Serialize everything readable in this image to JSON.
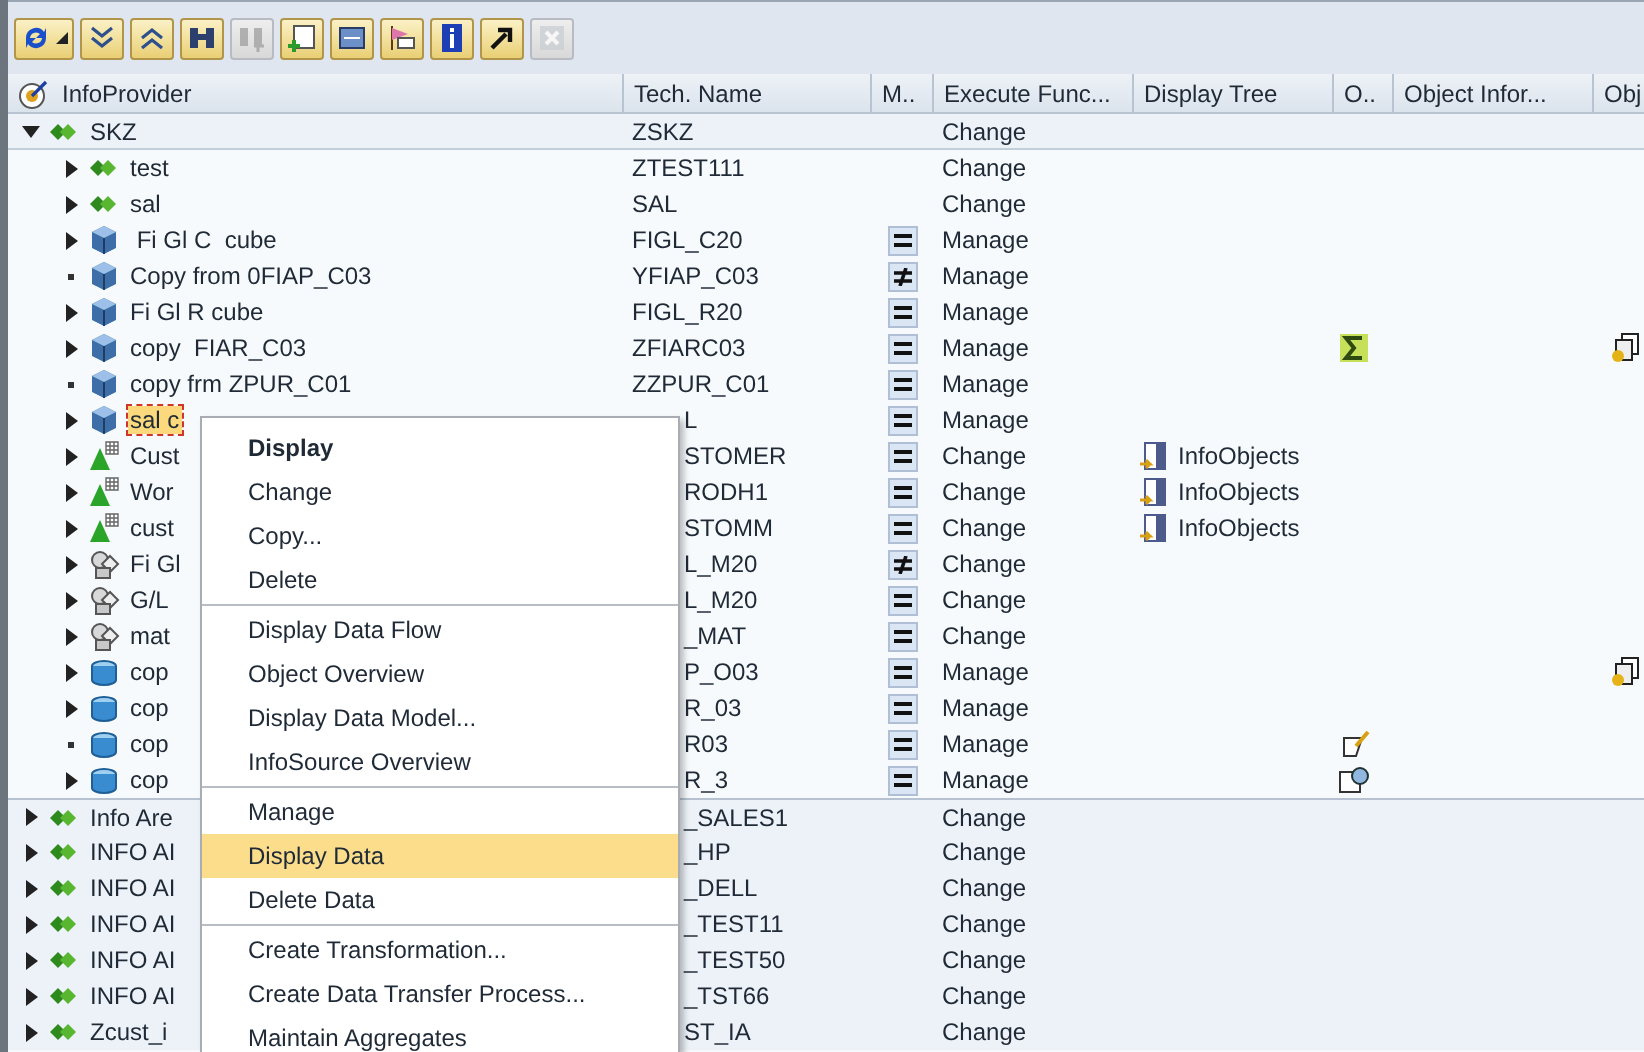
{
  "toolbar": [
    {
      "kind": "refresh",
      "has_menu": true,
      "disabled": false
    },
    {
      "kind": "expand",
      "has_menu": false,
      "disabled": false
    },
    {
      "kind": "collapse",
      "has_menu": false,
      "disabled": false
    },
    {
      "kind": "find",
      "has_menu": false,
      "disabled": false
    },
    {
      "kind": "find-next",
      "has_menu": false,
      "disabled": true
    },
    {
      "kind": "create",
      "has_menu": false,
      "disabled": false
    },
    {
      "kind": "screen",
      "has_menu": false,
      "disabled": false
    },
    {
      "kind": "flag",
      "has_menu": false,
      "disabled": false
    },
    {
      "kind": "info",
      "has_menu": false,
      "disabled": false
    },
    {
      "kind": "jump",
      "has_menu": false,
      "disabled": false
    },
    {
      "kind": "cancel",
      "has_menu": false,
      "disabled": true
    }
  ],
  "table": {
    "columns": [
      "InfoProvider",
      "Tech. Name",
      "M..",
      "Execute Func...",
      "Display Tree",
      "O..",
      "Object Infor...",
      "Obj"
    ],
    "rows": [
      {
        "label": "SKZ",
        "tech_name": "ZSKZ",
        "kind": "area",
        "expanded": true,
        "leaf": false,
        "selected": false,
        "execute": "Change",
        "children": [
          {
            "label": "test",
            "tech_name": "ZTEST111",
            "kind": "area",
            "expanded": false,
            "leaf": false,
            "selected": false,
            "execute": "Change"
          },
          {
            "label": "sal",
            "tech_name": "SAL",
            "kind": "area",
            "expanded": false,
            "leaf": false,
            "selected": false,
            "execute": "Change"
          },
          {
            "label": " Fi Gl C  cube",
            "tech_name": "FIGL_C20",
            "kind": "cube",
            "expanded": false,
            "leaf": false,
            "selected": false,
            "m_column": {
              "kind": "equal"
            },
            "execute": "Manage"
          },
          {
            "label": "Copy from 0FIAP_C03",
            "tech_name": "YFIAP_C03",
            "kind": "cube",
            "leaf": true,
            "selected": false,
            "m_column": {
              "kind": "unequal"
            },
            "execute": "Manage"
          },
          {
            "label": "Fi Gl R cube",
            "tech_name": "FIGL_R20",
            "kind": "cube",
            "expanded": false,
            "leaf": false,
            "selected": false,
            "m_column": {
              "kind": "equal"
            },
            "execute": "Manage"
          },
          {
            "label": "copy  FIAR_C03",
            "tech_name": "ZFIARC03",
            "kind": "cube",
            "expanded": false,
            "leaf": false,
            "selected": false,
            "m_column": {
              "kind": "equal"
            },
            "execute": "Manage",
            "o_column": {
              "kind": "sum"
            },
            "obj_column": {
              "kind": "copy"
            }
          },
          {
            "label": "copy frm ZPUR_C01",
            "tech_name": "ZZPUR_C01",
            "kind": "cube",
            "leaf": true,
            "selected": false,
            "m_column": {
              "kind": "equal"
            },
            "execute": "Manage"
          },
          {
            "label": "sal c",
            "tech_name": "L",
            "kind": "cube",
            "expanded": false,
            "leaf": false,
            "selected": true,
            "m_column": {
              "kind": "equal"
            },
            "execute": "Manage"
          },
          {
            "label": "Cust",
            "tech_name": "STOMER",
            "kind": "multiprovider",
            "expanded": false,
            "leaf": false,
            "selected": false,
            "m_column": {
              "kind": "equal"
            },
            "execute": "Change",
            "display_tree": "InfoObjects"
          },
          {
            "label": "Wor",
            "tech_name": "RODH1",
            "kind": "multiprovider",
            "expanded": false,
            "leaf": false,
            "selected": false,
            "m_column": {
              "kind": "equal"
            },
            "execute": "Change",
            "display_tree": "InfoObjects"
          },
          {
            "label": "cust",
            "tech_name": "STOMM",
            "kind": "multiprovider",
            "expanded": false,
            "leaf": false,
            "selected": false,
            "m_column": {
              "kind": "equal"
            },
            "execute": "Change",
            "display_tree": "InfoObjects"
          },
          {
            "label": "Fi Gl",
            "tech_name": "L_M20",
            "kind": "infoset",
            "expanded": false,
            "leaf": false,
            "selected": false,
            "m_column": {
              "kind": "unequal"
            },
            "execute": "Change"
          },
          {
            "label": "G/L",
            "tech_name": "L_M20",
            "kind": "infoset",
            "expanded": false,
            "leaf": false,
            "selected": false,
            "m_column": {
              "kind": "equal"
            },
            "execute": "Change"
          },
          {
            "label": "mat",
            "tech_name": "_MAT",
            "kind": "infoset",
            "expanded": false,
            "leaf": false,
            "selected": false,
            "m_column": {
              "kind": "equal"
            },
            "execute": "Change"
          },
          {
            "label": "cop",
            "tech_name": "P_O03",
            "kind": "dso",
            "expanded": false,
            "leaf": false,
            "selected": false,
            "m_column": {
              "kind": "equal"
            },
            "execute": "Manage",
            "obj_column": {
              "kind": "copy"
            }
          },
          {
            "label": "cop",
            "tech_name": "R_03",
            "kind": "dso",
            "expanded": false,
            "leaf": false,
            "selected": false,
            "m_column": {
              "kind": "equal"
            },
            "execute": "Manage"
          },
          {
            "label": "cop",
            "tech_name": "R03",
            "kind": "dso",
            "leaf": true,
            "selected": false,
            "m_column": {
              "kind": "equal"
            },
            "execute": "Manage",
            "o_column": {
              "kind": "edit"
            }
          },
          {
            "label": "cop",
            "tech_name": "R_3",
            "kind": "dso",
            "expanded": false,
            "leaf": false,
            "selected": false,
            "m_column": {
              "kind": "equal"
            },
            "execute": "Manage",
            "o_column": {
              "kind": "clock"
            }
          }
        ]
      },
      {
        "label": "Info Are",
        "tech_name": "_SALES1",
        "kind": "area",
        "expanded": false,
        "leaf": false,
        "selected": false,
        "execute": "Change"
      },
      {
        "label": "INFO AI",
        "tech_name": "_HP",
        "kind": "area",
        "expanded": false,
        "leaf": false,
        "selected": false,
        "execute": "Change"
      },
      {
        "label": "INFO AI",
        "tech_name": "_DELL",
        "kind": "area",
        "expanded": false,
        "leaf": false,
        "selected": false,
        "execute": "Change"
      },
      {
        "label": "INFO AI",
        "tech_name": "_TEST11",
        "kind": "area",
        "expanded": false,
        "leaf": false,
        "selected": false,
        "execute": "Change"
      },
      {
        "label": "INFO AI",
        "tech_name": "_TEST50",
        "kind": "area",
        "expanded": false,
        "leaf": false,
        "selected": false,
        "execute": "Change"
      },
      {
        "label": "INFO AI",
        "tech_name": "_TST66",
        "kind": "area",
        "expanded": false,
        "leaf": false,
        "selected": false,
        "execute": "Change"
      },
      {
        "label": "Zcust_i",
        "tech_name": "ST_IA",
        "kind": "area",
        "expanded": false,
        "leaf": false,
        "selected": false,
        "execute": "Change"
      }
    ]
  },
  "context_menu": {
    "groups": [
      [
        {
          "label": "Display",
          "default": true,
          "selected": false
        },
        {
          "label": "Change",
          "default": false,
          "selected": false
        },
        {
          "label": "Copy...",
          "default": false,
          "selected": false
        },
        {
          "label": "Delete",
          "default": false,
          "selected": false
        }
      ],
      [
        {
          "label": "Display Data Flow",
          "default": false,
          "selected": false
        },
        {
          "label": "Object Overview",
          "default": false,
          "selected": false
        },
        {
          "label": "Display Data Model...",
          "default": false,
          "selected": false
        },
        {
          "label": "InfoSource Overview",
          "default": false,
          "selected": false
        }
      ],
      [
        {
          "label": "Manage",
          "default": false,
          "selected": false
        },
        {
          "label": "Display Data",
          "default": false,
          "selected": true
        },
        {
          "label": "Delete Data",
          "default": false,
          "selected": false
        }
      ],
      [
        {
          "label": "Create Transformation...",
          "default": false,
          "selected": false
        },
        {
          "label": "Create Data Transfer Process...",
          "default": false,
          "selected": false
        },
        {
          "label": "Maintain Aggregates",
          "default": false,
          "selected": false
        }
      ]
    ]
  }
}
